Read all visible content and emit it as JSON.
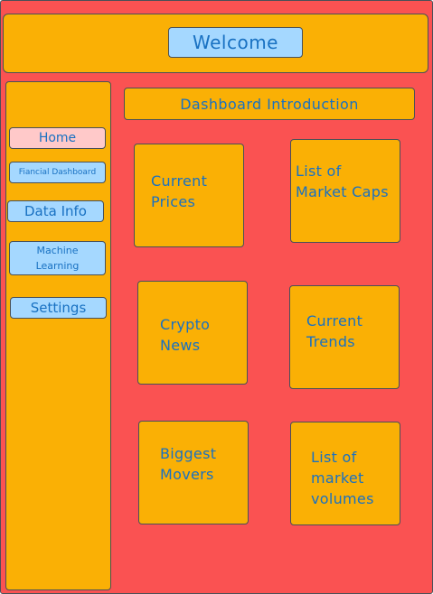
{
  "header": {
    "welcome_label": "Welcome"
  },
  "sidebar": {
    "home": "Home",
    "financial_dashboard": "Fiancial Dashboard",
    "data_info": "Data Info",
    "machine_learning": "Machine\nLearning",
    "settings": "Settings"
  },
  "main": {
    "intro": "Dashboard Introduction",
    "cards": {
      "current_prices": "Current\nPrices",
      "market_caps": "List of\nMarket Caps",
      "crypto_news": "Crypto\nNews",
      "current_trends": "Current\nTrends",
      "biggest_movers": "Biggest\nMovers",
      "market_volumes": "List of\nmarket\nvolumes"
    }
  },
  "colors": {
    "background": "#fa5252",
    "panel": "#fab005",
    "button": "#a5d8ff",
    "active_button": "#ffc9c9",
    "text": "#1971c2"
  }
}
